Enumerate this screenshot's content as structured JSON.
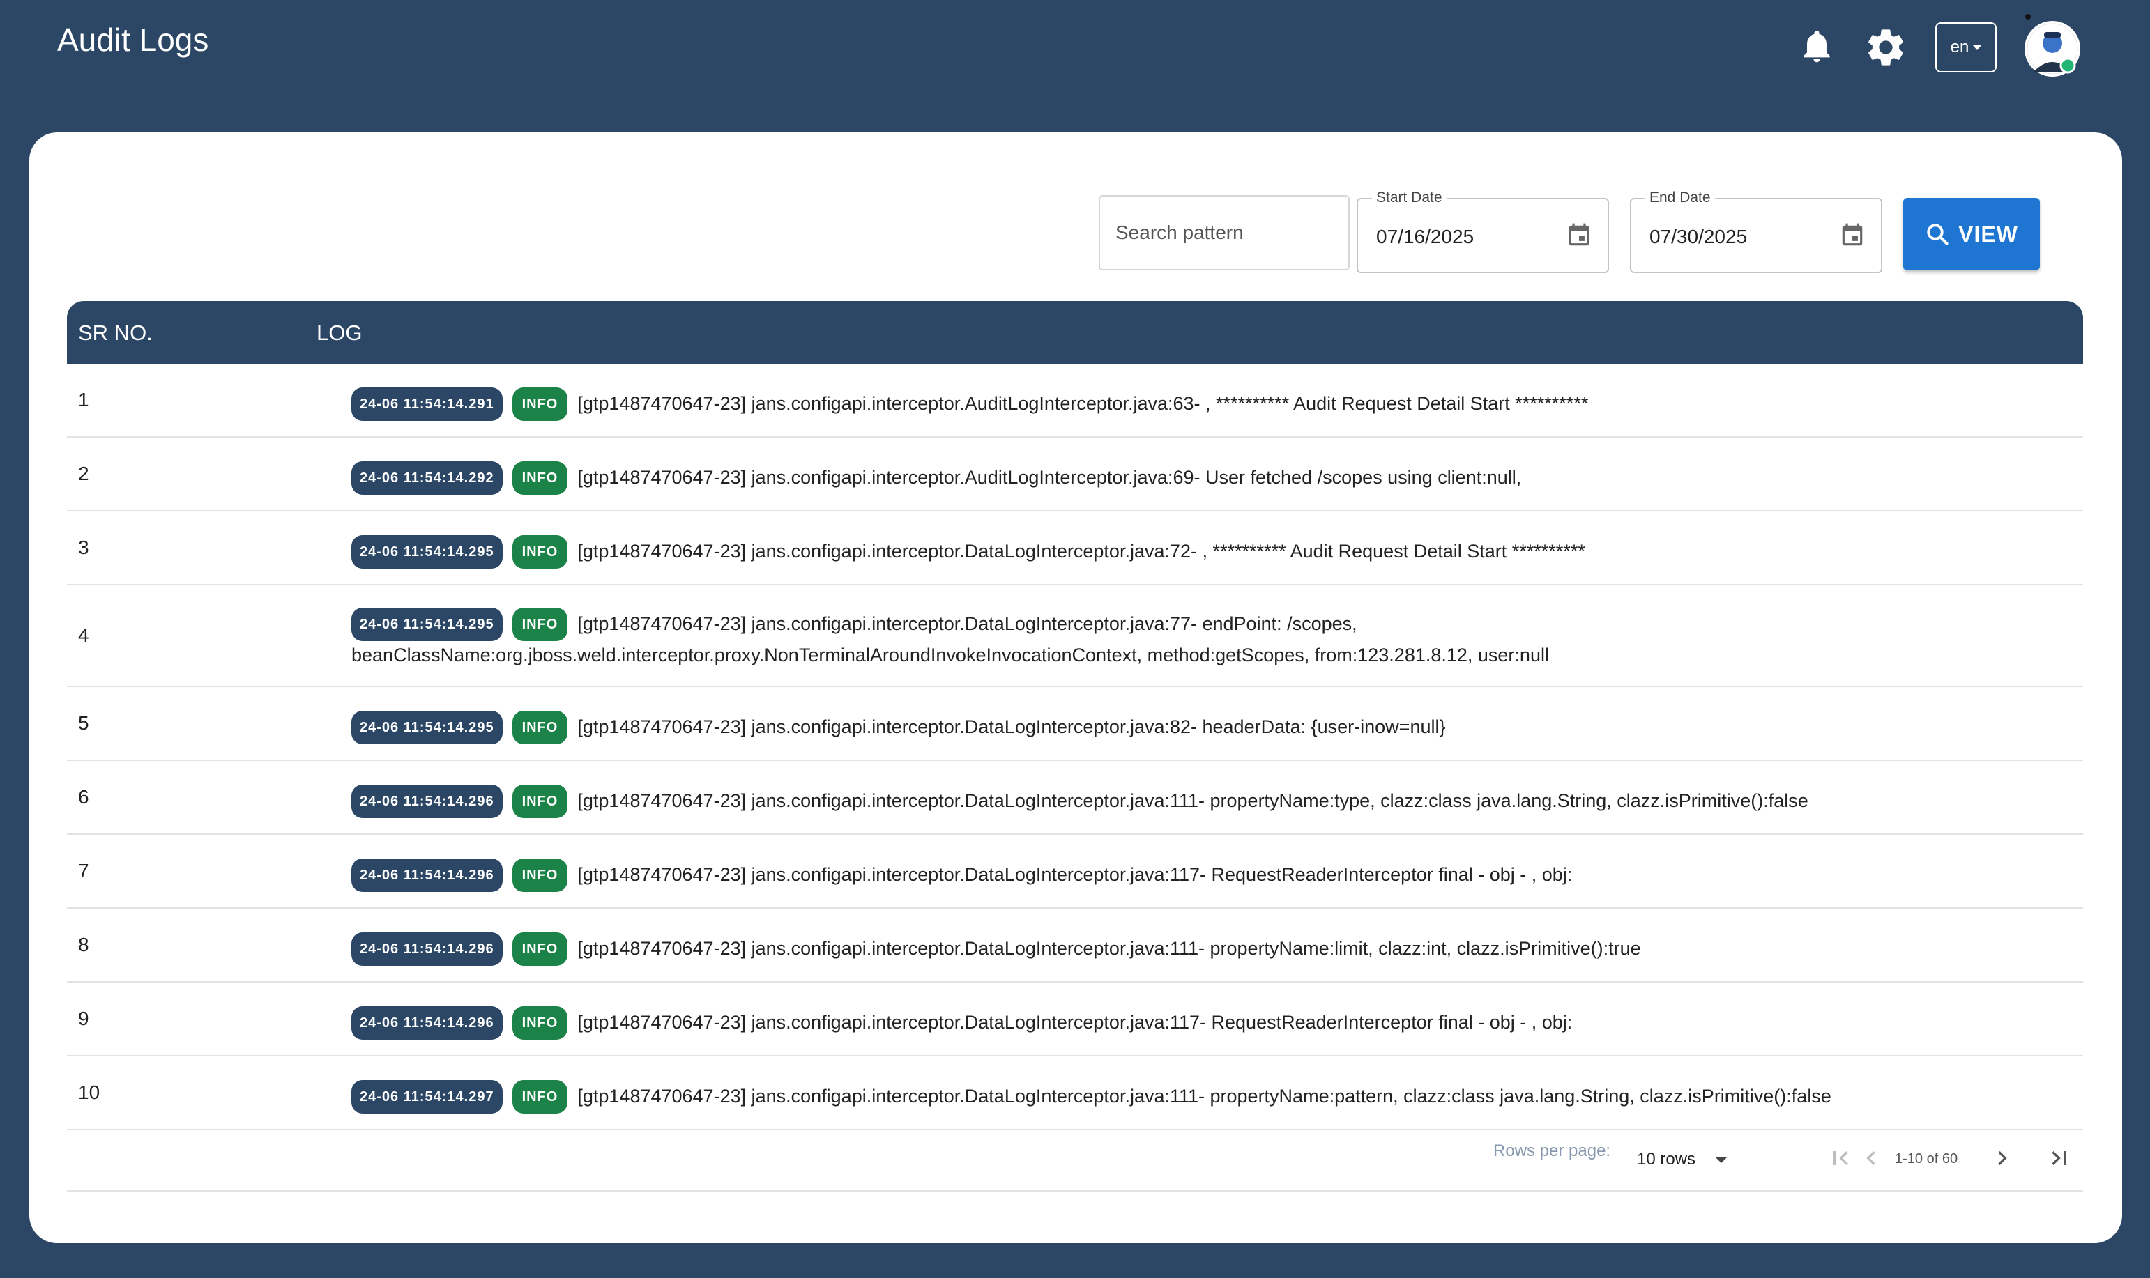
{
  "header": {
    "title": "Audit Logs",
    "language": "en"
  },
  "filters": {
    "search_placeholder": "Search pattern",
    "start_date_label": "Start Date",
    "start_date_value": "07/16/2025",
    "end_date_label": "End Date",
    "end_date_value": "07/30/2025",
    "view_label": "VIEW"
  },
  "table": {
    "columns": [
      "SR NO.",
      "LOG"
    ],
    "rows": [
      {
        "sr": "1",
        "ts": "24-06 11:54:14.291",
        "level": "INFO",
        "msg": "[gtp1487470647-23] jans.configapi.interceptor.AuditLogInterceptor.java:63- , ********** Audit Request Detail Start **********"
      },
      {
        "sr": "2",
        "ts": "24-06 11:54:14.292",
        "level": "INFO",
        "msg": "[gtp1487470647-23] jans.configapi.interceptor.AuditLogInterceptor.java:69- User fetched /scopes using client:null,"
      },
      {
        "sr": "3",
        "ts": "24-06 11:54:14.295",
        "level": "INFO",
        "msg": "[gtp1487470647-23] jans.configapi.interceptor.DataLogInterceptor.java:72- , ********** Audit Request Detail Start **********"
      },
      {
        "sr": "4",
        "ts": "24-06 11:54:14.295",
        "level": "INFO",
        "msg": "[gtp1487470647-23] jans.configapi.interceptor.DataLogInterceptor.java:77- endPoint: /scopes, beanClassName:org.jboss.weld.interceptor.proxy.NonTerminalAroundInvokeInvocationContext, method:getScopes, from:123.281.8.12, user:null"
      },
      {
        "sr": "5",
        "ts": "24-06 11:54:14.295",
        "level": "INFO",
        "msg": "[gtp1487470647-23] jans.configapi.interceptor.DataLogInterceptor.java:82- headerData: {user-inow=null}"
      },
      {
        "sr": "6",
        "ts": "24-06 11:54:14.296",
        "level": "INFO",
        "msg": "[gtp1487470647-23] jans.configapi.interceptor.DataLogInterceptor.java:111- propertyName:type, clazz:class java.lang.String, clazz.isPrimitive():false"
      },
      {
        "sr": "7",
        "ts": "24-06 11:54:14.296",
        "level": "INFO",
        "msg": "[gtp1487470647-23] jans.configapi.interceptor.DataLogInterceptor.java:117- RequestReaderInterceptor final - obj - , obj:"
      },
      {
        "sr": "8",
        "ts": "24-06 11:54:14.296",
        "level": "INFO",
        "msg": "[gtp1487470647-23] jans.configapi.interceptor.DataLogInterceptor.java:111- propertyName:limit, clazz:int, clazz.isPrimitive():true"
      },
      {
        "sr": "9",
        "ts": "24-06 11:54:14.296",
        "level": "INFO",
        "msg": "[gtp1487470647-23] jans.configapi.interceptor.DataLogInterceptor.java:117- RequestReaderInterceptor final - obj - , obj:"
      },
      {
        "sr": "10",
        "ts": "24-06 11:54:14.297",
        "level": "INFO",
        "msg": "[gtp1487470647-23] jans.configapi.interceptor.DataLogInterceptor.java:111- propertyName:pattern, clazz:class java.lang.String, clazz.isPrimitive():false"
      }
    ]
  },
  "pagination": {
    "rows_per_page_label": "Rows per page:",
    "rows_per_page_value": "10 rows",
    "range": "1-10 of 60"
  },
  "colors": {
    "brand": "#2c4765",
    "accent": "#1f76d2",
    "info_badge": "#1c8348"
  },
  "icons": [
    "bell-icon",
    "gear-icon",
    "avatar",
    "calendar-icon",
    "search-icon",
    "first-page-icon",
    "prev-page-icon",
    "next-page-icon",
    "last-page-icon"
  ]
}
